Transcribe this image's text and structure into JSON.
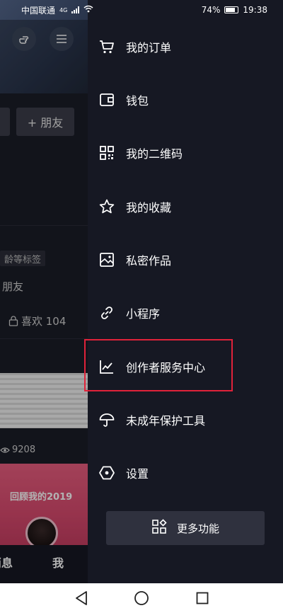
{
  "status_bar": {
    "carrier": "中国联通",
    "network": "4G",
    "battery": "74%",
    "time": "19:38"
  },
  "background_page": {
    "button_friends": "+ 朋友",
    "tag_text": "龄等标签",
    "friends_text": "朋友",
    "likes_text": "喜欢 104",
    "views_text": "9208",
    "thumb_title": "回顾我的2019",
    "nav_messages": "消息",
    "nav_me": "我"
  },
  "drawer": {
    "items": [
      {
        "label": "我的订单",
        "icon": "cart-icon"
      },
      {
        "label": "钱包",
        "icon": "wallet-icon"
      },
      {
        "label": "我的二维码",
        "icon": "qr-code-icon"
      },
      {
        "label": "我的收藏",
        "icon": "star-icon"
      },
      {
        "label": "私密作品",
        "icon": "image-icon"
      },
      {
        "label": "小程序",
        "icon": "link-icon"
      },
      {
        "label": "创作者服务中心",
        "icon": "chart-icon"
      },
      {
        "label": "未成年保护工具",
        "icon": "umbrella-icon"
      },
      {
        "label": "设置",
        "icon": "settings-hexagon-icon"
      }
    ],
    "more_button": "更多功能"
  },
  "colors": {
    "drawer_bg": "#161823",
    "highlight": "#e0223a",
    "button_bg": "#2f313e"
  }
}
